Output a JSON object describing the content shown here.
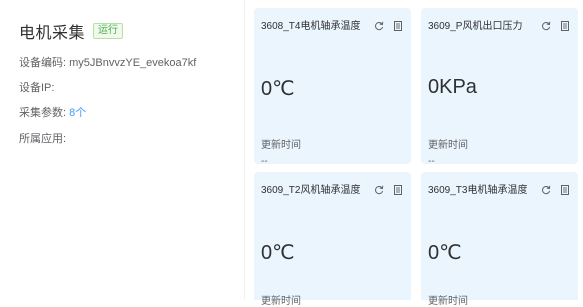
{
  "device": {
    "name": "电机采集",
    "status": "运行",
    "code_label": "设备编码:",
    "code_value": "my5JBnvvzYE_evekoa7kf",
    "ip_label": "设备IP:",
    "ip_value": "",
    "params_label": "采集参数:",
    "params_value": "8个",
    "app_label": "所属应用:",
    "app_value": ""
  },
  "cards": [
    {
      "name": "3608_T4电机轴承温度",
      "value": "0℃",
      "update_label": "更新时间",
      "update_value": "--"
    },
    {
      "name": "3609_P风机出口压力",
      "value": "0KPa",
      "update_label": "更新时间",
      "update_value": "--"
    },
    {
      "name": "3609_T2风机轴承温度",
      "value": "0℃",
      "update_label": "更新时间",
      "update_value": "--"
    },
    {
      "name": "3609_T3电机轴承温度",
      "value": "0℃",
      "update_label": "更新时间",
      "update_value": "--"
    }
  ],
  "icons": {
    "refresh": "refresh-icon",
    "detail": "document-icon"
  },
  "colors": {
    "card_bg": "#eaf5fd",
    "link": "#409eff",
    "status_green": "#4caf50"
  }
}
